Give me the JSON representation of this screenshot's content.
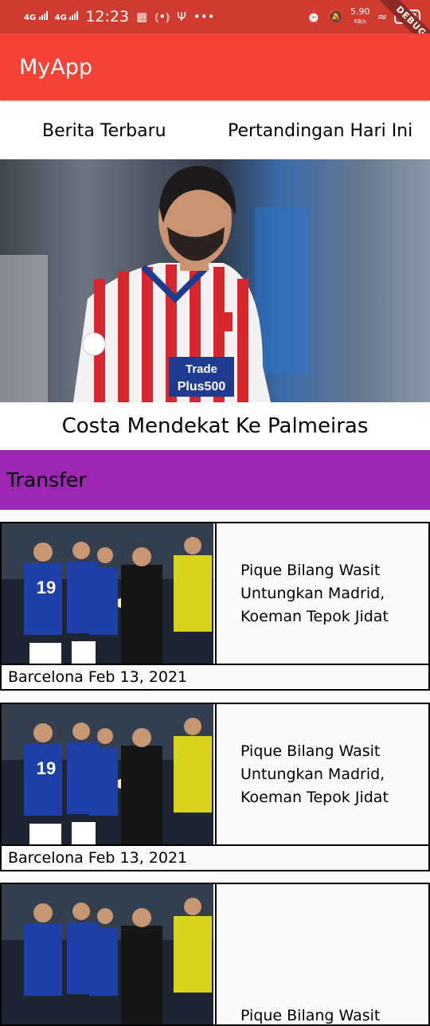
{
  "status_bar": {
    "network_1": "4G",
    "network_2": "4G",
    "time": "12:23",
    "speed_value": "5.90",
    "speed_unit": "KB/s",
    "battery": "100",
    "debug_label": "DEBUG"
  },
  "app_bar": {
    "title": "MyApp"
  },
  "tabs": [
    {
      "label": "Berita Terbaru"
    },
    {
      "label": "Pertandingan Hari Ini"
    }
  ],
  "hero": {
    "caption": "Costa Mendekat Ke Palmeiras",
    "jersey_text_1": "Trade",
    "jersey_text_2": "Plus500"
  },
  "category": {
    "label": "Transfer",
    "color": "#9c27b0"
  },
  "news": [
    {
      "title": "Pique Bilang Wasit\nUntungkan Madrid,\nKoeman Tepok Jidat",
      "meta": "Barcelona Feb 13, 2021"
    },
    {
      "title": "Pique Bilang Wasit\nUntungkan Madrid,\nKoeman Tepok Jidat",
      "meta": "Barcelona Feb 13, 2021"
    },
    {
      "title": "Pique Bilang Wasit",
      "meta": ""
    }
  ],
  "colors": {
    "app_bar": "#f44336",
    "status_bar": "#d03a2f",
    "category": "#9c27b0"
  }
}
